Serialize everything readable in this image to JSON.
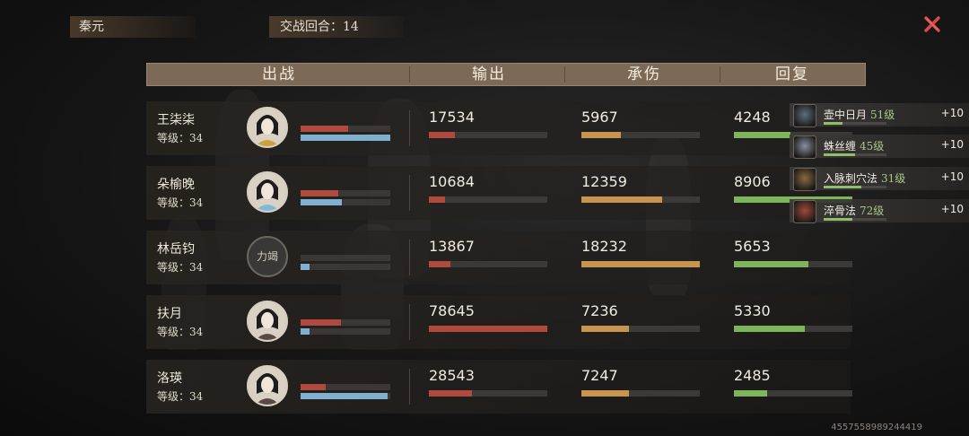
{
  "player": {
    "name": "秦元"
  },
  "battle": {
    "round_label": "交战回合：14"
  },
  "columns": {
    "deploy": "出战",
    "output": "输出",
    "damage_taken": "承伤",
    "heal": "回复"
  },
  "colors": {
    "output": "#b04a3e",
    "damage_taken": "#c7954e",
    "heal": "#7fb55a",
    "hp": "#b04a3e",
    "mp": "#7fb0d0"
  },
  "rows": [
    {
      "name": "王柒柒",
      "level": "等级：34",
      "hp": 0.53,
      "mp": 1.0,
      "output": "17534",
      "output_frac": 0.22,
      "damage": "5967",
      "damage_frac": 0.33,
      "heal": "4248",
      "heal_frac": 0.48
    },
    {
      "name": "朵榆晚",
      "level": "等级：34",
      "hp": 0.42,
      "mp": 0.46,
      "output": "10684",
      "output_frac": 0.14,
      "damage": "12359",
      "damage_frac": 0.68,
      "heal": "8906",
      "heal_frac": 1.0
    },
    {
      "name": "林岳钧",
      "level": "等级：34",
      "hp": 0.0,
      "mp": 0.1,
      "output": "13867",
      "output_frac": 0.18,
      "damage": "18232",
      "damage_frac": 1.0,
      "heal": "5653",
      "heal_frac": 0.63
    },
    {
      "name": "扶月",
      "level": "等级：34",
      "hp": 0.45,
      "mp": 0.1,
      "output": "78645",
      "output_frac": 1.0,
      "damage": "7236",
      "damage_frac": 0.4,
      "heal": "5330",
      "heal_frac": 0.6
    },
    {
      "name": "洛瑛",
      "level": "等级：34",
      "hp": 0.28,
      "mp": 0.97,
      "output": "28543",
      "output_frac": 0.36,
      "damage": "7247",
      "damage_frac": 0.4,
      "heal": "2485",
      "heal_frac": 0.28
    }
  ],
  "buffs": [
    {
      "name": "壶中日月",
      "level": "51级",
      "bonus": "+10",
      "icon": "moon-icon",
      "progress": 0.3
    },
    {
      "name": "蛛丝缠",
      "level": "45级",
      "bonus": "+10",
      "icon": "spider-silk-icon",
      "progress": 0.5
    },
    {
      "name": "入脉刺穴法",
      "level": "31级",
      "bonus": "+10",
      "icon": "acupuncture-icon",
      "progress": 0.6
    },
    {
      "name": "淬骨法",
      "level": "72级",
      "bonus": "+10",
      "icon": "bone-temper-icon",
      "progress": 0.45
    }
  ],
  "locked_avatar_text": "力竭",
  "user_id": "4557558989244419"
}
